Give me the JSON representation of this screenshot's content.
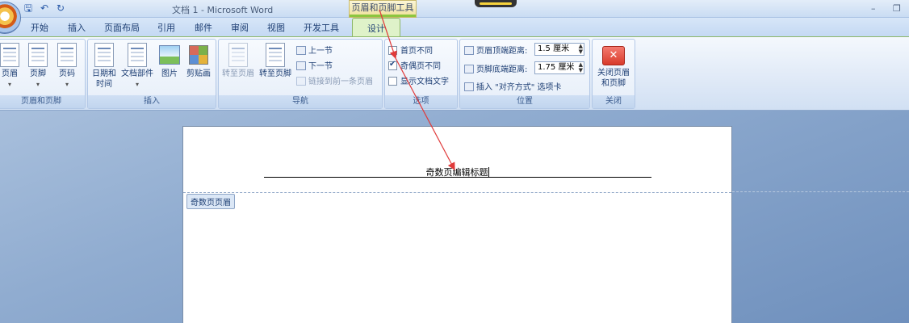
{
  "titlebar": {
    "title": "文档 1 - Microsoft Word",
    "context_title": "页眉和页脚工具",
    "qat": [
      "save-icon",
      "undo-icon",
      "redo-icon"
    ],
    "qat_glyphs": [
      "🖫",
      "↶",
      "↻"
    ],
    "minimize": "–",
    "restore": "❐"
  },
  "tabs": [
    "开始",
    "插入",
    "页面布局",
    "引用",
    "邮件",
    "审阅",
    "视图",
    "开发工具"
  ],
  "active_tab": "设计",
  "groups": {
    "header_footer": {
      "label": "页眉和页脚",
      "buttons": [
        "页眉",
        "页脚",
        "页码"
      ]
    },
    "insert": {
      "label": "插入",
      "date_time_1": "日期和",
      "date_time_2": "时间",
      "doc_parts": "文档部件",
      "picture": "图片",
      "clipart": "剪贴画"
    },
    "navigation": {
      "label": "导航",
      "goto_header": "转至页眉",
      "goto_footer": "转至页脚",
      "prev_section": "上一节",
      "next_section": "下一节",
      "link_previous": "链接到前一条页眉"
    },
    "options": {
      "label": "选项",
      "different_first": "首页不同",
      "different_odd_even": "奇偶页不同",
      "show_doc_text": "显示文档文字",
      "different_first_checked": false,
      "different_odd_even_checked": true,
      "show_doc_text_checked": false
    },
    "position": {
      "label": "位置",
      "header_top_label": "页眉顶端距离:",
      "header_top_value": "1.5 厘米",
      "footer_bottom_label": "页脚底端距离:",
      "footer_bottom_value": "1.75 厘米",
      "insert_align_tab": "插入 \"对齐方式\" 选项卡"
    },
    "close": {
      "label": "关闭",
      "close_1": "关闭页眉",
      "close_2": "和页脚"
    }
  },
  "document": {
    "header_text": "奇数页编辑标题",
    "header_tag": "奇数页页眉"
  },
  "colors": {
    "annotation_arrow": "#e03a3a",
    "context_tab_accent": "#8cc63f"
  }
}
